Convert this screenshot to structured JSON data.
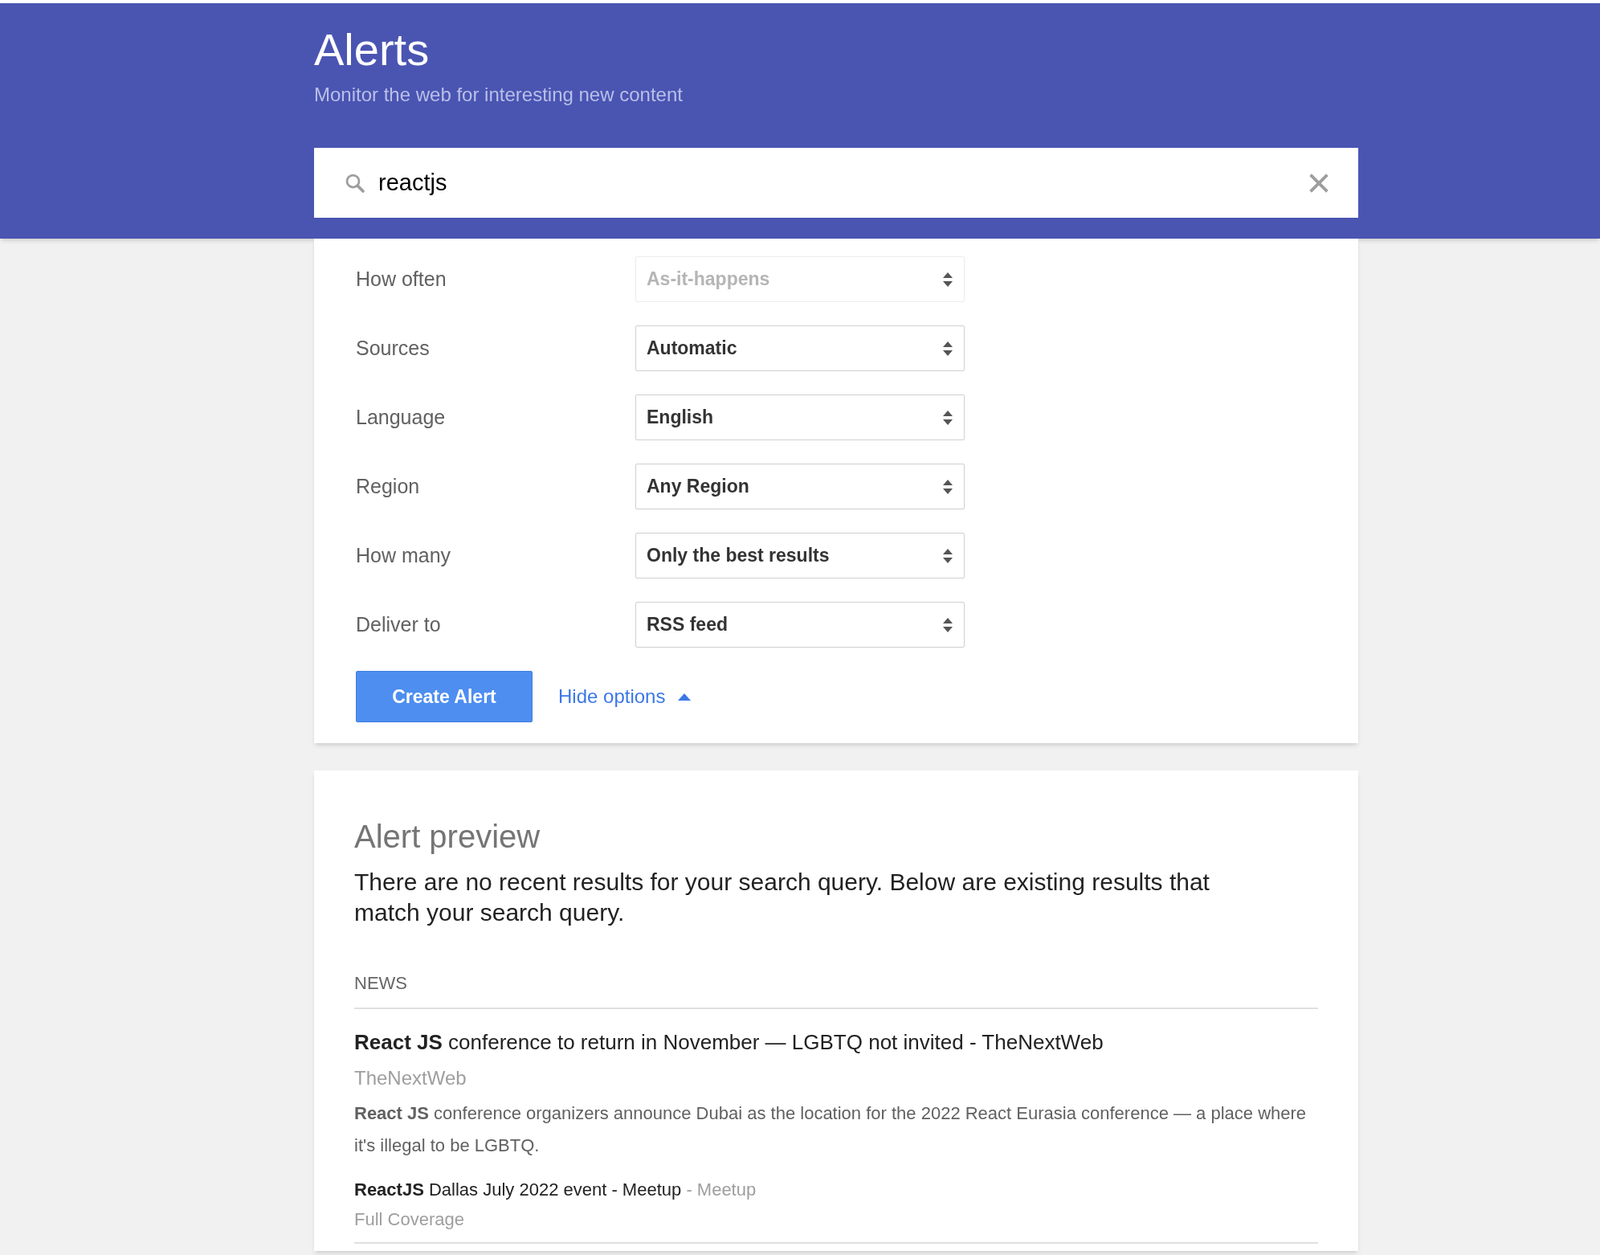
{
  "header": {
    "title": "Alerts",
    "subtitle": "Monitor the web for interesting new content"
  },
  "search": {
    "value": "reactjs"
  },
  "options": [
    {
      "label": "How often",
      "value": "As-it-happens",
      "disabled": true
    },
    {
      "label": "Sources",
      "value": "Automatic",
      "disabled": false
    },
    {
      "label": "Language",
      "value": "English",
      "disabled": false
    },
    {
      "label": "Region",
      "value": "Any Region",
      "disabled": false
    },
    {
      "label": "How many",
      "value": "Only the best results",
      "disabled": false
    },
    {
      "label": "Deliver to",
      "value": "RSS feed",
      "disabled": false
    }
  ],
  "create_button": "Create Alert",
  "hide_options": "Hide options",
  "preview": {
    "title": "Alert preview",
    "message": "There are no recent results for your search query. Below are existing results that match your search query.",
    "section": "NEWS",
    "articles": [
      {
        "title": "**React JS** conference to return in November — LGBTQ not invited - TheNextWeb",
        "source": "TheNextWeb",
        "snippet": "**React JS** conference organizers announce Dubai as the location for the 2022 React Eurasia conference — a place where it's illegal to be LGBTQ."
      }
    ],
    "related": {
      "title": "**ReactJS** Dallas July 2022 event - Meetup",
      "source": "- Meetup",
      "link": "Full Coverage"
    }
  }
}
